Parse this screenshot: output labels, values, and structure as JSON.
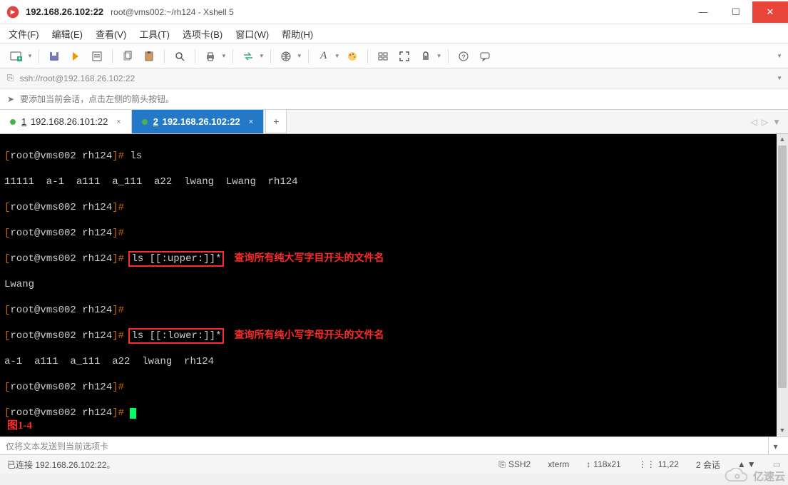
{
  "window": {
    "title": "192.168.26.102:22",
    "subtitle": "root@vms002:~/rh124 - Xshell 5"
  },
  "menu": {
    "file": "文件(F)",
    "edit": "编辑(E)",
    "view": "查看(V)",
    "tools": "工具(T)",
    "tabs": "选项卡(B)",
    "window": "窗口(W)",
    "help": "帮助(H)"
  },
  "addressbar": {
    "url": "ssh://root@192.168.26.102:22"
  },
  "hintbar": {
    "text": "要添加当前会话，点击左侧的箭头按钮。"
  },
  "tabs": {
    "items": [
      {
        "index": "1",
        "label": "192.168.26.101:22",
        "active": false
      },
      {
        "index": "2",
        "label": "192.168.26.102:22",
        "active": true
      }
    ]
  },
  "terminal": {
    "prompt_open": "[",
    "prompt_body": "root@vms002 rh124",
    "prompt_close": "]#",
    "lines": {
      "l0_cmd": "ls",
      "l1_out": "11111  a-1  a111  a_111  a22  lwang  Lwang  rh124",
      "l4_cmd": "ls [[:upper:]]*",
      "l4_annot": "查询所有纯大写字目开头的文件名",
      "l5_out": "Lwang",
      "l7_cmd": "ls [[:lower:]]*",
      "l7_annot": "查询所有纯小写字母开头的文件名",
      "l8_out": "a-1  a111  a_111  a22  lwang  rh124"
    },
    "figure_label": "图1-4"
  },
  "sendbar": {
    "placeholder": "仅将文本发送到当前选项卡"
  },
  "statusbar": {
    "connected": "已连接 192.168.26.102:22。",
    "protocol": "SSH2",
    "term": "xterm",
    "size": "118x21",
    "cursor": "11,22",
    "sessions": "2 会话"
  },
  "watermark": {
    "text": "亿速云"
  },
  "icons": {
    "newterm": "new-terminal-icon",
    "disk": "disk-icon",
    "flash": "reconnect-icon",
    "props": "properties-icon",
    "copy": "copy-icon",
    "paste": "paste-icon",
    "search": "search-icon",
    "print": "print-icon",
    "arrowlr": "transfer-icon",
    "globe": "globe-icon",
    "font": "font-icon",
    "palette": "palette-icon",
    "users": "sessions-icon",
    "fullscreen": "fullscreen-icon",
    "lock": "lock-icon",
    "help": "help-icon",
    "bubble": "feedback-icon"
  }
}
